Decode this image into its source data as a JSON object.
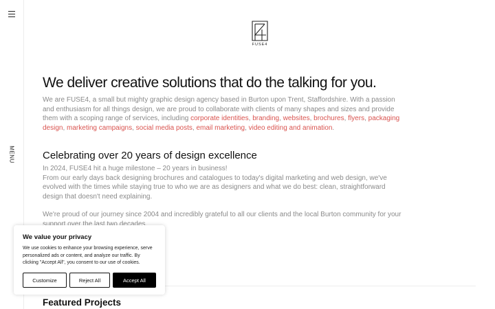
{
  "sidebar": {
    "menu_label": "MENU"
  },
  "logo": {
    "text": "FUSE4"
  },
  "hero": {
    "headline": "We deliver creative solutions that do the talking for you.",
    "intro_text": "We are FUSE4, a small but mighty graphic design agency based in Burton upon Trent, Staffordshire. With a passion and enthusiasm for all things design, we are proud to collaborate with clients of many shapes and sizes and provide them with a scoping range of services, including",
    "services": [
      "corporate identities",
      "branding",
      "websites",
      "brochures",
      "flyers",
      "packaging design",
      "marketing campaigns",
      "social media posts",
      "email marketing",
      "video editing and animation"
    ],
    "sep_1": ",",
    "sep_2": ",",
    "sep_3": ",",
    "sep_4": ",",
    "sep_5": ",",
    "sep_6": ",",
    "sep_7": ",",
    "sep_8": ",",
    "sep_9": ",",
    "end_dot": "."
  },
  "celebrate": {
    "title": "Celebrating over 20 years of design excellence",
    "para1_line1": "In 2024, FUSE4 hit a huge milestone – 20 years in business!",
    "para1_line2": "From our early days back designing brochures and catalogues to today's digital marketing and web design, we've evolved with the times while staying true to who we are as designers and what we do best: clean, straightforward design that doesn't need explaining.",
    "para2": "We're proud of our journey since 2004 and incredibly grateful to all our clients and the local Burton community for your support over the last two decades."
  },
  "featured": {
    "title": "Featured Projects"
  },
  "cookie": {
    "title": "We value your privacy",
    "text": "We use cookies to enhance your browsing experience, serve personalized ads or content, and analyze our traffic. By clicking \"Accept All\", you consent to our use of cookies.",
    "customize_label": "Customize",
    "reject_label": "Reject All",
    "accept_label": "Accept All"
  }
}
